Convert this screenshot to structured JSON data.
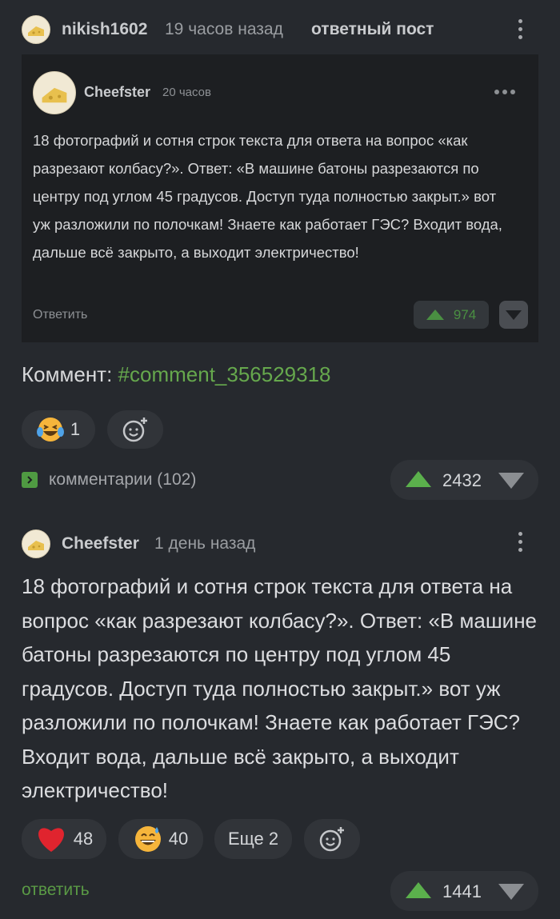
{
  "post": {
    "author": "nikish1602",
    "time": "19 часов назад",
    "tag": "ответный пост",
    "quote": {
      "author": "Cheefster",
      "time": "20 часов",
      "text": "18 фотографий и сотня строк текста для ответа на вопрос «как разрезают колбасу?». Ответ: «В машине батоны разрезаются по центру под углом 45 градусов. Доступ туда полностью закрыт.» вот уж разложили по полочкам! Знаете как работает ГЭС? Входит вода, дальше всё закрыто, а выходит электричество!",
      "reply_label": "Ответить",
      "rating": "974"
    },
    "comment_label": "Коммент: ",
    "comment_link": "#comment_356529318",
    "reactions": [
      {
        "emoji": "laugh-tears",
        "count": "1"
      }
    ],
    "comments_label": "комментарии (102)",
    "rating": "2432"
  },
  "comment": {
    "author": "Cheefster",
    "time": "1 день назад",
    "text": "18 фотографий и сотня строк текста для ответа на вопрос «как разрезают колбасу?». Ответ: «В машине батоны разрезаются по центру под углом 45 градусов. Доступ туда полностью закрыт.» вот уж разложили по полочкам! Знаете как работает ГЭС? Входит вода, дальше всё закрыто, а выходит электричество!",
    "reactions": [
      {
        "emoji": "heart",
        "count": "48"
      },
      {
        "emoji": "grin-sweat",
        "count": "40"
      }
    ],
    "more_label": "Еще 2",
    "reply_label": "ответить",
    "rating": "1441"
  },
  "colors": {
    "background": "#26292e",
    "accent_green": "#5bb04c",
    "link_green": "#66a84d"
  }
}
